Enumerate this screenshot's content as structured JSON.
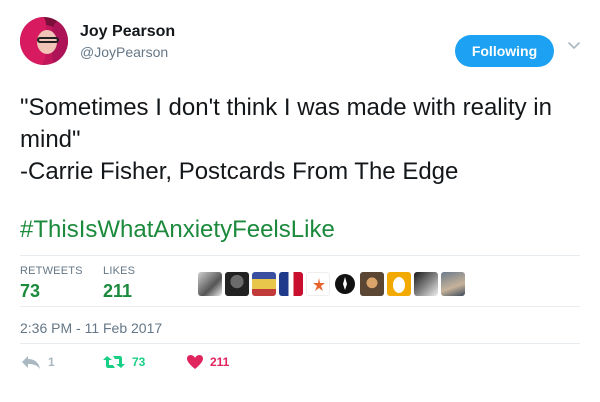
{
  "author": {
    "name": "Joy Pearson",
    "handle": "@JoyPearson"
  },
  "follow_button": {
    "label": "Following"
  },
  "tweet": {
    "lines": [
      "\"Sometimes I don't think I was made with reality in",
      "mind\"",
      "-Carrie Fisher, Postcards From The Edge"
    ],
    "hashtag": "#ThisIsWhatAnxietyFeelsLike"
  },
  "stats": {
    "retweets_label": "RETWEETS",
    "retweets_value": "73",
    "likes_label": "LIKES",
    "likes_value": "211"
  },
  "timestamp": "2:36 PM - 11 Feb 2017",
  "actions": {
    "reply_count": "1",
    "retweet_count": "73",
    "like_count": "211"
  },
  "colors": {
    "accent": "#1da1f2",
    "link": "#1b8a3c",
    "retweet": "#19cf86",
    "like": "#e0245e",
    "muted": "#657786"
  },
  "icons": [
    "chevron-down-icon",
    "reply-icon",
    "retweet-icon",
    "heart-icon"
  ]
}
